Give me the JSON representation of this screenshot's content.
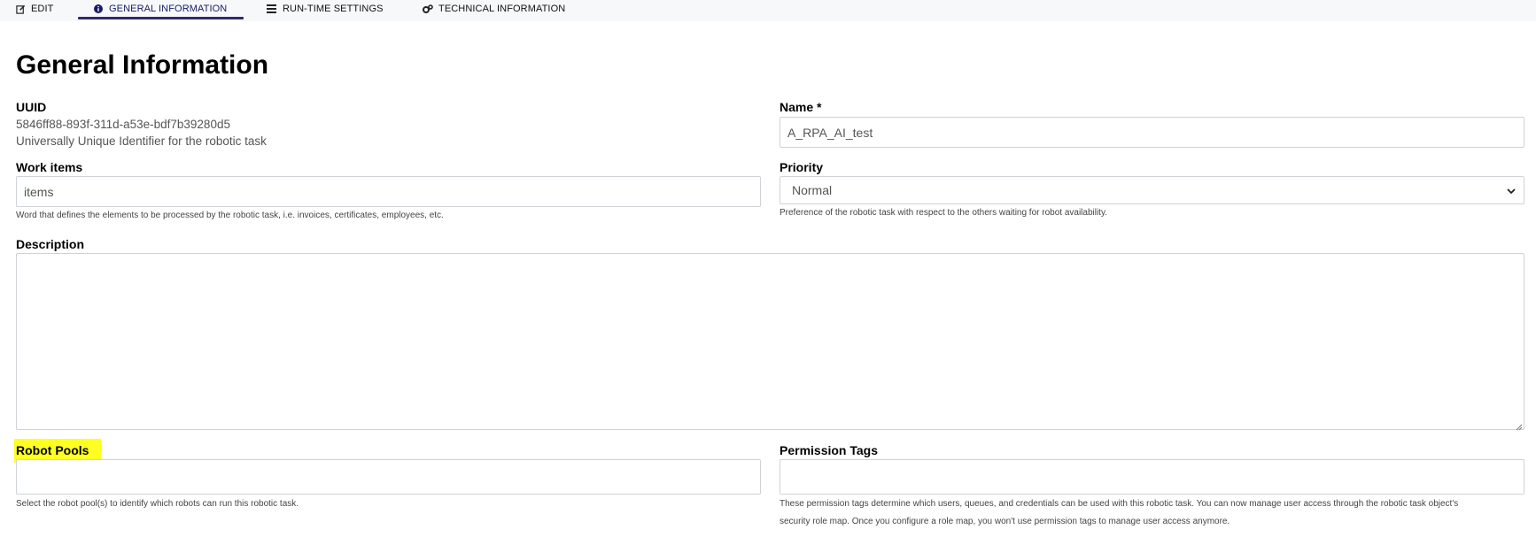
{
  "tabs": [
    {
      "label": "EDIT",
      "icon": "edit-icon"
    },
    {
      "label": "GENERAL INFORMATION",
      "icon": "info-circle-icon"
    },
    {
      "label": "RUN-TIME SETTINGS",
      "icon": "list-settings-icon"
    },
    {
      "label": "TECHNICAL INFORMATION",
      "icon": "gears-icon"
    }
  ],
  "active_tab": "GENERAL INFORMATION",
  "page_title": "General Information",
  "uuid": {
    "label": "UUID",
    "value": "5846ff88-893f-311d-a53e-bdf7b39280d5",
    "help": "Universally Unique Identifier for the robotic task"
  },
  "name": {
    "label": "Name *",
    "value": "A_RPA_AI_test"
  },
  "work_items": {
    "label": "Work items",
    "value": "items",
    "help": "Word that defines the elements to be processed by the robotic task, i.e. invoices, certificates, employees, etc."
  },
  "priority": {
    "label": "Priority",
    "value": "Normal",
    "help": "Preference of the robotic task with respect to the others waiting for robot availability."
  },
  "description": {
    "label": "Description",
    "value": ""
  },
  "robot_pools": {
    "label": "Robot Pools",
    "value": "",
    "help": "Select the robot pool(s) to identify which robots can run this robotic task.",
    "highlight_color": "#ffff22"
  },
  "permission_tags": {
    "label": "Permission Tags",
    "value": "",
    "help_line1": "These permission tags determine which users, queues, and credentials can be used with this robotic task. You can now manage user access through the robotic task object's",
    "help_line2": "security role map. Once you configure a role map, you won't use permission tags to manage user access anymore."
  },
  "colors": {
    "accent": "#2c2c6e",
    "tabbar_bg": "#f6f8fa",
    "border": "#cfd3d8"
  }
}
